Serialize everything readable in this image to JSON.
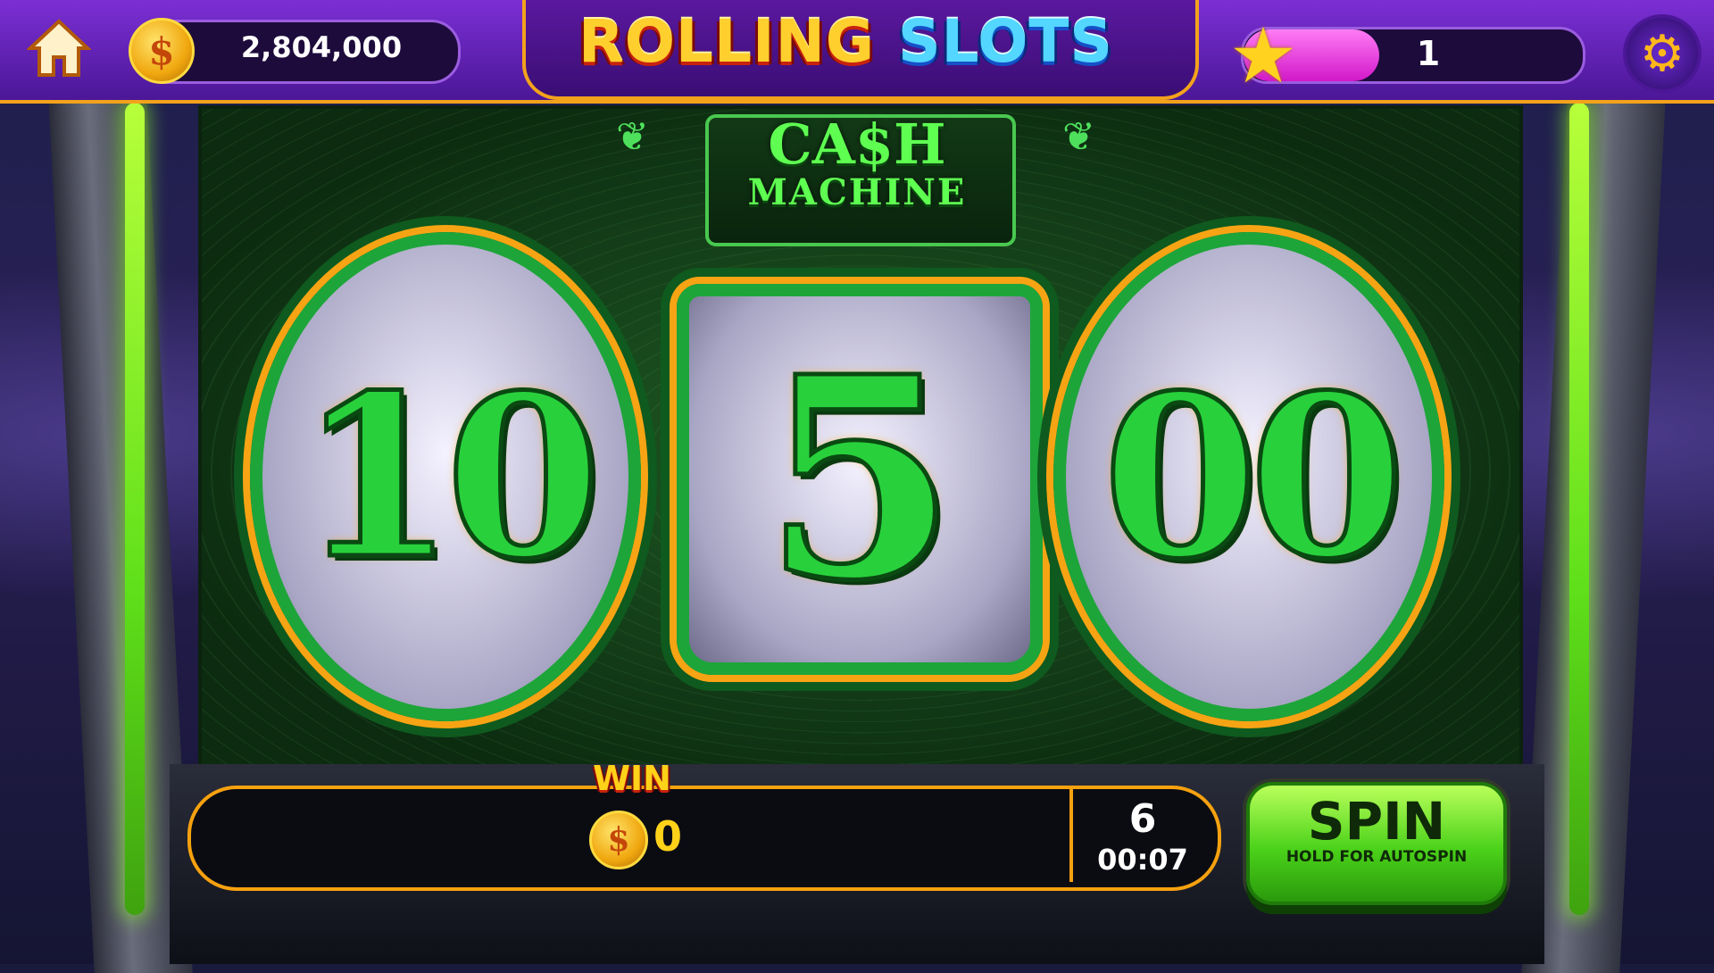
{
  "header": {
    "coin_symbol": "$",
    "balance": "2,804,000",
    "logo_word_1": "ROLLING",
    "logo_word_2": "SLOTS",
    "level": "1",
    "level_progress_percent": 40
  },
  "machine": {
    "title_line_1": "CA$H",
    "title_line_2": "MACHINE",
    "reels": [
      "10",
      "5",
      "00"
    ]
  },
  "controls": {
    "win_label": "WIN",
    "win_amount": "0",
    "lines": "6",
    "timer": "00:07",
    "spin_label": "SPIN",
    "spin_sub": "HOLD FOR AUTOSPIN"
  },
  "colors": {
    "accent_orange": "#f6a10f",
    "reel_green": "#28d13c",
    "header_purple": "#7b2fd4"
  },
  "icons": {
    "home": "home-icon",
    "coin": "coin-icon",
    "star": "star-icon",
    "settings": "gear-icon"
  }
}
